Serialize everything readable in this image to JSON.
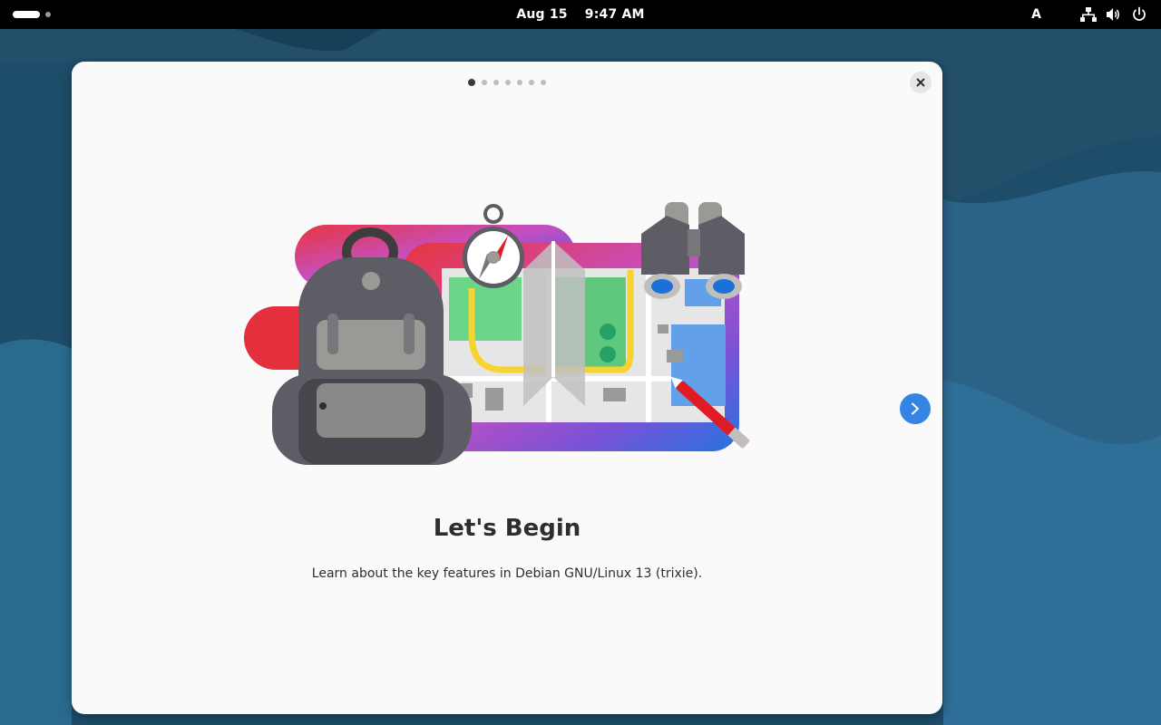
{
  "topbar": {
    "date": "Aug 15",
    "time": "9:47 AM",
    "keyboard_layout": "A",
    "icons": [
      "network-icon",
      "volume-icon",
      "power-icon"
    ]
  },
  "dialog": {
    "pages_total": 7,
    "current_page": 1,
    "title": "Let's Begin",
    "description": "Learn about the key features in Debian GNU/Linux 13 (trixie).",
    "accent_color": "#3584e4"
  }
}
